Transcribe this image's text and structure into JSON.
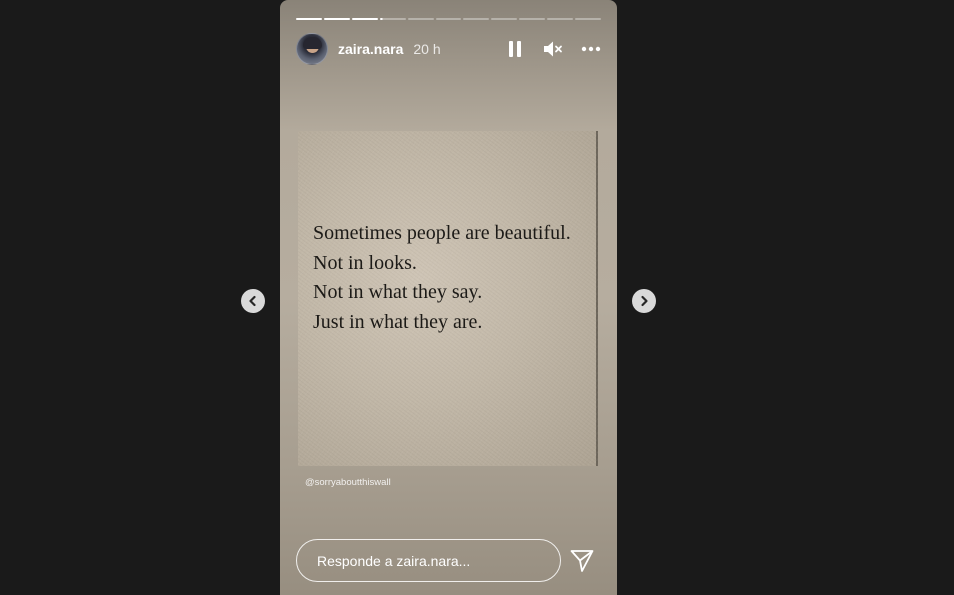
{
  "story": {
    "progress": {
      "segments_total": 11,
      "segments_completed": 3,
      "current_segment_fraction": 0.1
    },
    "header": {
      "username": "zaira.nara",
      "time": "20 h",
      "pause_icon": "pause-icon",
      "mute_icon": "speaker-muted-icon",
      "more_icon": "more-horizontal-icon"
    },
    "quote_lines": [
      "Sometimes people are beautiful.",
      "Not in looks.",
      "Not in what they say.",
      "Just in what they are."
    ],
    "credit": "@sorryaboutthiswall",
    "reply": {
      "placeholder": "Responde a zaira.nara..."
    },
    "send_icon": "paper-plane-icon"
  },
  "navigation": {
    "prev_icon": "chevron-left-icon",
    "next_icon": "chevron-right-icon"
  },
  "colors": {
    "page_background": "#1a1a1a",
    "story_background": "#b3aa9c",
    "paper": "#c2b8a8",
    "text_dark": "#1c1a17",
    "nav_button": "#d9d9d9"
  }
}
